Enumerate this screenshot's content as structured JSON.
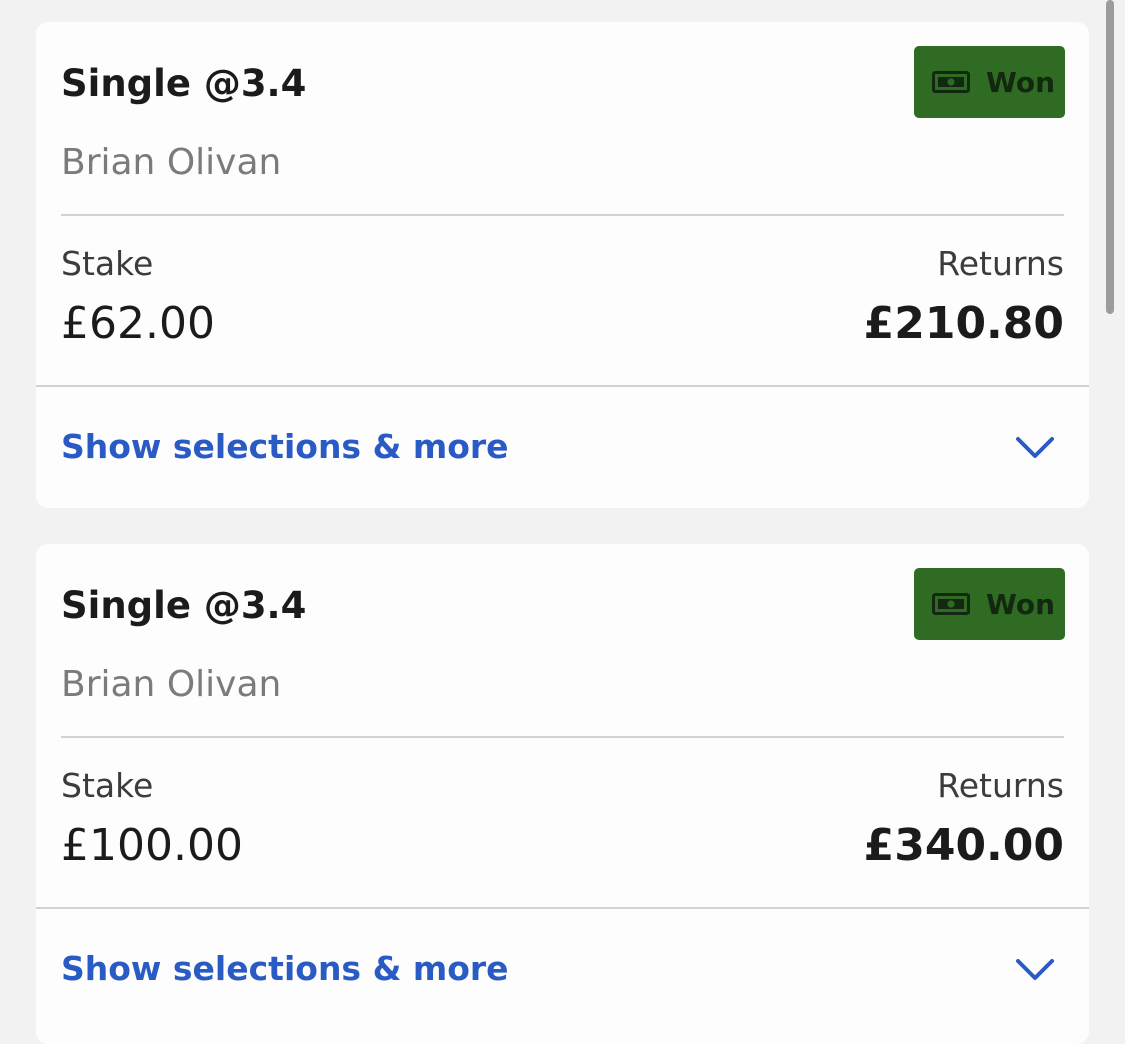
{
  "colors": {
    "won_badge_bg": "#2f6b22",
    "link_blue": "#2a5bc4"
  },
  "bets": [
    {
      "title": "Single @3.4",
      "selection": "Brian Olivan",
      "status": {
        "label": "Won",
        "icon": "money-icon"
      },
      "stake_label": "Stake",
      "stake_value": "£62.00",
      "returns_label": "Returns",
      "returns_value": "£210.80",
      "expand_label": "Show selections & more",
      "expand_icon": "chevron-down-icon"
    },
    {
      "title": "Single @3.4",
      "selection": "Brian Olivan",
      "status": {
        "label": "Won",
        "icon": "money-icon"
      },
      "stake_label": "Stake",
      "stake_value": "£100.00",
      "returns_label": "Returns",
      "returns_value": "£340.00",
      "expand_label": "Show selections & more",
      "expand_icon": "chevron-down-icon"
    }
  ]
}
